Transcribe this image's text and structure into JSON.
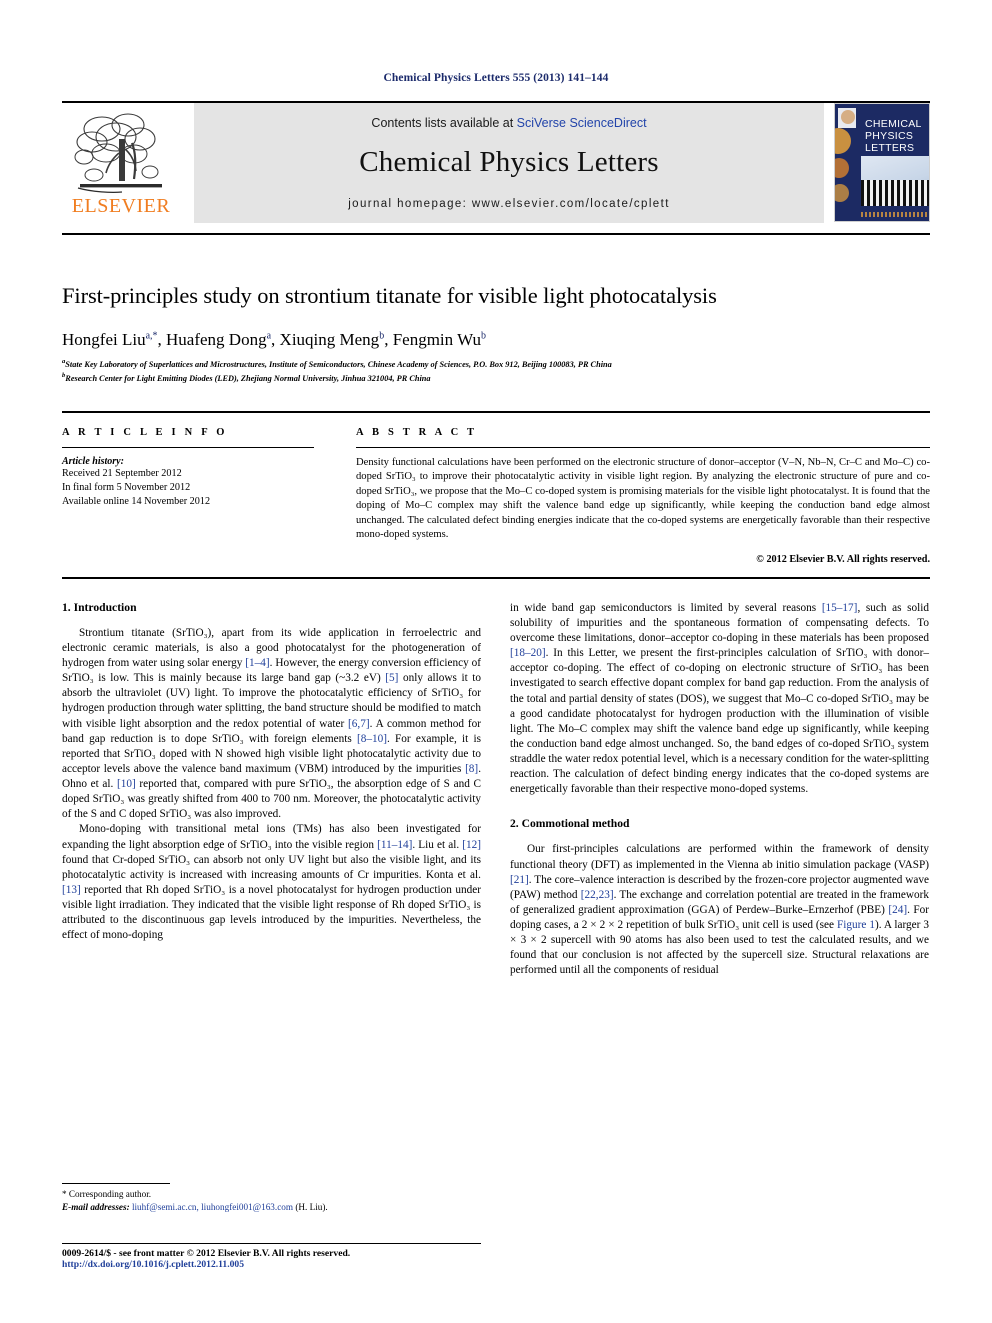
{
  "running_head": "Chemical Physics Letters 555 (2013) 141–144",
  "masthead": {
    "publisher_name": "ELSEVIER",
    "contents_prefix": "Contents lists available at ",
    "contents_link": "SciVerse ScienceDirect",
    "journal_title": "Chemical Physics Letters",
    "journal_homepage": "journal homepage: www.elsevier.com/locate/cplett",
    "cover_title_line1": "CHEMICAL",
    "cover_title_line2": "PHYSICS",
    "cover_title_line3": "LETTERS"
  },
  "article": {
    "title": "First-principles study on strontium titanate for visible light photocatalysis",
    "authors": [
      {
        "name": "Hongfei Liu",
        "sup": "a,*"
      },
      {
        "name": "Huafeng Dong",
        "sup": "a"
      },
      {
        "name": "Xiuqing Meng",
        "sup": "b"
      },
      {
        "name": "Fengmin Wu",
        "sup": "b"
      }
    ],
    "affiliations": [
      {
        "label": "a",
        "text": "State Key Laboratory of Superlattices and Microstructures, Institute of Semiconductors, Chinese Academy of Sciences, P.O. Box 912, Beijing 100083, PR China"
      },
      {
        "label": "b",
        "text": "Research Center for Light Emitting Diodes (LED), Zhejiang Normal University, Jinhua 321004, PR China"
      }
    ]
  },
  "article_info": {
    "heading": "A R T I C L E   I N F O",
    "history_label": "Article history:",
    "history": [
      "Received 21 September 2012",
      "In final form 5 November 2012",
      "Available online 14 November 2012"
    ]
  },
  "abstract": {
    "heading": "A B S T R A C T",
    "text": "Density functional calculations have been performed on the electronic structure of donor–acceptor (V–N, Nb–N, Cr–C and Mo–C) co-doped SrTiO₃ to improve their photocatalytic activity in visible light region. By analyzing the electronic structure of pure and co-doped SrTiO₃, we propose that the Mo–C co-doped system is promising materials for the visible light photocatalyst. It is found that the doping of Mo–C complex may shift the valence band edge up significantly, while keeping the conduction band edge almost unchanged. The calculated defect binding energies indicate that the co-doped systems are energetically favorable than their respective mono-doped systems.",
    "copyright": "© 2012 Elsevier B.V. All rights reserved."
  },
  "sections": {
    "intro_heading": "1. Introduction",
    "method_heading": "2. Commotional method"
  },
  "body": {
    "left": [
      "Strontium titanate (SrTiO₃), apart from its wide application in ferroelectric and electronic ceramic materials, is also a good photocatalyst for the photogeneration of hydrogen from water using solar energy [1–4]. However, the energy conversion efficiency of SrTiO₃ is low. This is mainly because its large band gap (~3.2 eV) [5] only allows it to absorb the ultraviolet (UV) light. To improve the photocatalytic efficiency of SrTiO₃ for hydrogen production through water splitting, the band structure should be modified to match with visible light absorption and the redox potential of water [6,7]. A common method for band gap reduction is to dope SrTiO₃ with foreign elements [8–10]. For example, it is reported that SrTiO₃ doped with N showed high visible light photocatalytic activity due to acceptor levels above the valence band maximum (VBM) introduced by the impurities [8]. Ohno et al. [10] reported that, compared with pure SrTiO₃, the absorption edge of S and C doped SrTiO₃ was greatly shifted from 400 to 700 nm. Moreover, the photocatalytic activity of the S and C doped SrTiO₃ was also improved.",
      "Mono-doping with transitional metal ions (TMs) has also been investigated for expanding the light absorption edge of SrTiO₃ into the visible region [11–14]. Liu et al. [12] found that Cr-doped SrTiO₃ can absorb not only UV light but also the visible light, and its photocatalytic activity is increased with increasing amounts of Cr impurities. Konta et al. [13] reported that Rh doped SrTiO₃ is a novel photocatalyst for hydrogen production under visible light irradiation. They indicated that the visible light response of Rh doped SrTiO₃ is attributed to the discontinuous gap levels introduced by the impurities. Nevertheless, the effect of mono-doping"
    ],
    "right": [
      "in wide band gap semiconductors is limited by several reasons [15–17], such as solid solubility of impurities and the spontaneous formation of compensating defects. To overcome these limitations, donor–acceptor co-doping in these materials has been proposed [18–20]. In this Letter, we present the first-principles calculation of SrTiO₃ with donor–acceptor co-doping. The effect of co-doping on electronic structure of SrTiO₃ has been investigated to search effective dopant complex for band gap reduction. From the analysis of the total and partial density of states (DOS), we suggest that Mo–C co-doped SrTiO₃ may be a good candidate photocatalyst for hydrogen production with the illumination of visible light. The Mo–C complex may shift the valence band edge up significantly, while keeping the conduction band edge almost unchanged. So, the band edges of co-doped SrTiO₃ system straddle the water redox potential level, which is a necessary condition for the water-splitting reaction. The calculation of defect binding energy indicates that the co-doped systems are energetically favorable than their respective mono-doped systems.",
      "Our first-principles calculations are performed within the framework of density functional theory (DFT) as implemented in the Vienna ab initio simulation package (VASP) [21]. The core–valence interaction is described by the frozen-core projector augmented wave (PAW) method [22,23]. The exchange and correlation potential are treated in the framework of generalized gradient approximation (GGA) of Perdew–Burke–Ernzerhof (PBE) [24]. For doping cases, a 2 × 2 × 2 repetition of bulk SrTiO₃ unit cell is used (see Figure 1). A larger 3 × 3 × 2 supercell with 90 atoms has also been used to test the calculated results, and we found that our conclusion is not affected by the supercell size. Structural relaxations are performed until all the components of residual"
    ]
  },
  "footnote": {
    "corresponding": "* Corresponding author.",
    "email_label": "E-mail addresses:",
    "emails": "liuhf@semi.ac.cn, liuhongfei001@163.com",
    "email_suffix": "(H. Liu)."
  },
  "footer": {
    "issn_line": "0009-2614/$ - see front matter © 2012 Elsevier B.V. All rights reserved.",
    "doi_line": "http://dx.doi.org/10.1016/j.cplett.2012.11.005"
  },
  "colors": {
    "link_blue": "#21409a",
    "running_head_blue": "#1b2a6b",
    "elsevier_orange": "#f07d20",
    "banner_gray": "#e4e4e4",
    "cover_navy": "#1c2a63"
  }
}
